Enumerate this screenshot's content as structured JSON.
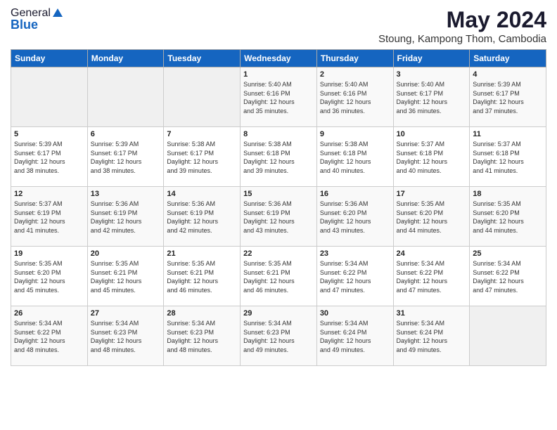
{
  "header": {
    "logo_general": "General",
    "logo_blue": "Blue",
    "title": "May 2024",
    "subtitle": "Stoung, Kampong Thom, Cambodia"
  },
  "weekdays": [
    "Sunday",
    "Monday",
    "Tuesday",
    "Wednesday",
    "Thursday",
    "Friday",
    "Saturday"
  ],
  "weeks": [
    [
      {
        "day": "",
        "info": ""
      },
      {
        "day": "",
        "info": ""
      },
      {
        "day": "",
        "info": ""
      },
      {
        "day": "1",
        "info": "Sunrise: 5:40 AM\nSunset: 6:16 PM\nDaylight: 12 hours\nand 35 minutes."
      },
      {
        "day": "2",
        "info": "Sunrise: 5:40 AM\nSunset: 6:16 PM\nDaylight: 12 hours\nand 36 minutes."
      },
      {
        "day": "3",
        "info": "Sunrise: 5:40 AM\nSunset: 6:17 PM\nDaylight: 12 hours\nand 36 minutes."
      },
      {
        "day": "4",
        "info": "Sunrise: 5:39 AM\nSunset: 6:17 PM\nDaylight: 12 hours\nand 37 minutes."
      }
    ],
    [
      {
        "day": "5",
        "info": "Sunrise: 5:39 AM\nSunset: 6:17 PM\nDaylight: 12 hours\nand 38 minutes."
      },
      {
        "day": "6",
        "info": "Sunrise: 5:39 AM\nSunset: 6:17 PM\nDaylight: 12 hours\nand 38 minutes."
      },
      {
        "day": "7",
        "info": "Sunrise: 5:38 AM\nSunset: 6:17 PM\nDaylight: 12 hours\nand 39 minutes."
      },
      {
        "day": "8",
        "info": "Sunrise: 5:38 AM\nSunset: 6:18 PM\nDaylight: 12 hours\nand 39 minutes."
      },
      {
        "day": "9",
        "info": "Sunrise: 5:38 AM\nSunset: 6:18 PM\nDaylight: 12 hours\nand 40 minutes."
      },
      {
        "day": "10",
        "info": "Sunrise: 5:37 AM\nSunset: 6:18 PM\nDaylight: 12 hours\nand 40 minutes."
      },
      {
        "day": "11",
        "info": "Sunrise: 5:37 AM\nSunset: 6:18 PM\nDaylight: 12 hours\nand 41 minutes."
      }
    ],
    [
      {
        "day": "12",
        "info": "Sunrise: 5:37 AM\nSunset: 6:19 PM\nDaylight: 12 hours\nand 41 minutes."
      },
      {
        "day": "13",
        "info": "Sunrise: 5:36 AM\nSunset: 6:19 PM\nDaylight: 12 hours\nand 42 minutes."
      },
      {
        "day": "14",
        "info": "Sunrise: 5:36 AM\nSunset: 6:19 PM\nDaylight: 12 hours\nand 42 minutes."
      },
      {
        "day": "15",
        "info": "Sunrise: 5:36 AM\nSunset: 6:19 PM\nDaylight: 12 hours\nand 43 minutes."
      },
      {
        "day": "16",
        "info": "Sunrise: 5:36 AM\nSunset: 6:20 PM\nDaylight: 12 hours\nand 43 minutes."
      },
      {
        "day": "17",
        "info": "Sunrise: 5:35 AM\nSunset: 6:20 PM\nDaylight: 12 hours\nand 44 minutes."
      },
      {
        "day": "18",
        "info": "Sunrise: 5:35 AM\nSunset: 6:20 PM\nDaylight: 12 hours\nand 44 minutes."
      }
    ],
    [
      {
        "day": "19",
        "info": "Sunrise: 5:35 AM\nSunset: 6:20 PM\nDaylight: 12 hours\nand 45 minutes."
      },
      {
        "day": "20",
        "info": "Sunrise: 5:35 AM\nSunset: 6:21 PM\nDaylight: 12 hours\nand 45 minutes."
      },
      {
        "day": "21",
        "info": "Sunrise: 5:35 AM\nSunset: 6:21 PM\nDaylight: 12 hours\nand 46 minutes."
      },
      {
        "day": "22",
        "info": "Sunrise: 5:35 AM\nSunset: 6:21 PM\nDaylight: 12 hours\nand 46 minutes."
      },
      {
        "day": "23",
        "info": "Sunrise: 5:34 AM\nSunset: 6:22 PM\nDaylight: 12 hours\nand 47 minutes."
      },
      {
        "day": "24",
        "info": "Sunrise: 5:34 AM\nSunset: 6:22 PM\nDaylight: 12 hours\nand 47 minutes."
      },
      {
        "day": "25",
        "info": "Sunrise: 5:34 AM\nSunset: 6:22 PM\nDaylight: 12 hours\nand 47 minutes."
      }
    ],
    [
      {
        "day": "26",
        "info": "Sunrise: 5:34 AM\nSunset: 6:22 PM\nDaylight: 12 hours\nand 48 minutes."
      },
      {
        "day": "27",
        "info": "Sunrise: 5:34 AM\nSunset: 6:23 PM\nDaylight: 12 hours\nand 48 minutes."
      },
      {
        "day": "28",
        "info": "Sunrise: 5:34 AM\nSunset: 6:23 PM\nDaylight: 12 hours\nand 48 minutes."
      },
      {
        "day": "29",
        "info": "Sunrise: 5:34 AM\nSunset: 6:23 PM\nDaylight: 12 hours\nand 49 minutes."
      },
      {
        "day": "30",
        "info": "Sunrise: 5:34 AM\nSunset: 6:24 PM\nDaylight: 12 hours\nand 49 minutes."
      },
      {
        "day": "31",
        "info": "Sunrise: 5:34 AM\nSunset: 6:24 PM\nDaylight: 12 hours\nand 49 minutes."
      },
      {
        "day": "",
        "info": ""
      }
    ]
  ]
}
